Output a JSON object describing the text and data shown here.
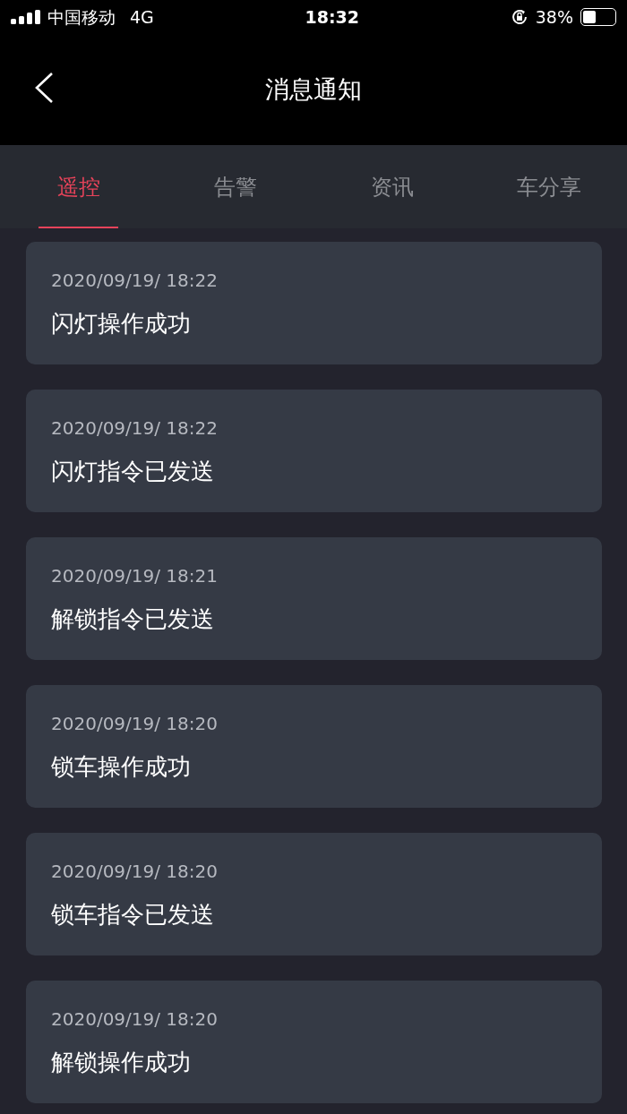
{
  "status_bar": {
    "carrier": "中国移动",
    "network": "4G",
    "time": "18:32",
    "battery": "38%"
  },
  "header": {
    "title": "消息通知"
  },
  "tabs": [
    {
      "label": "遥控",
      "selected": true
    },
    {
      "label": "告警",
      "selected": false
    },
    {
      "label": "资讯",
      "selected": false
    },
    {
      "label": "车分享",
      "selected": false
    }
  ],
  "messages": [
    {
      "time": "2020/09/19/ 18:22",
      "text": "闪灯操作成功"
    },
    {
      "time": "2020/09/19/ 18:22",
      "text": "闪灯指令已发送"
    },
    {
      "time": "2020/09/19/ 18:21",
      "text": "解锁指令已发送"
    },
    {
      "time": "2020/09/19/ 18:20",
      "text": "锁车操作成功"
    },
    {
      "time": "2020/09/19/ 18:20",
      "text": "锁车指令已发送"
    },
    {
      "time": "2020/09/19/ 18:20",
      "text": "解锁操作成功"
    }
  ]
}
